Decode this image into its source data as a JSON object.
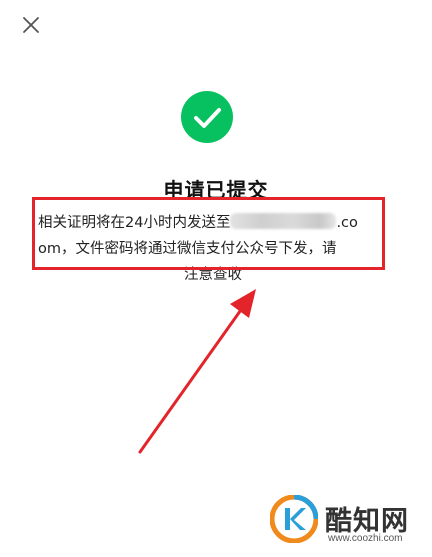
{
  "header": {
    "close_icon": "close-icon"
  },
  "status": {
    "icon": "check-circle-icon",
    "icon_color": "#07c160",
    "title": "申请已提交"
  },
  "message": {
    "line1_prefix": "相关证明将在24小时内发送至",
    "line1_suffix": ".co",
    "line2": "om，文件密码将通过微信支付公众号下发，请",
    "line3": "注意查收"
  },
  "annotation": {
    "highlight_color": "#e3242b",
    "arrow_color": "#e3242b"
  },
  "watermark": {
    "name": "酷知网",
    "url": "www.coozhi.com",
    "logo_colors": [
      "#f08a1c",
      "#2b9fd8"
    ]
  }
}
